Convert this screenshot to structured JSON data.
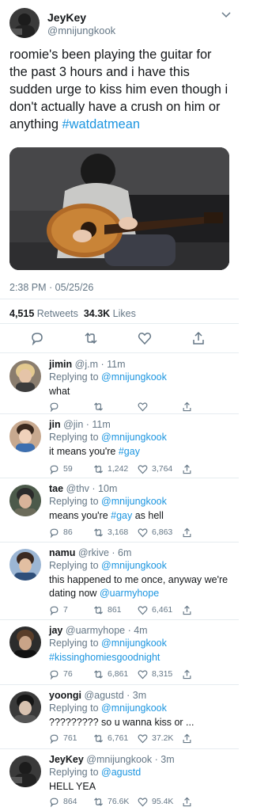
{
  "main_tweet": {
    "display_name": "JeyKey",
    "handle": "@mnijungkook",
    "text_parts": [
      "roomie's been playing the guitar for the past 3 hours and i have this sudden urge to kiss him even though i don't actually have a crush on him or anything ",
      "#watdatmean"
    ],
    "timestamp": "2:38 PM · 05/25/26",
    "retweets_count": "4,515",
    "retweets_label": "Retweets",
    "likes_count": "34.3K",
    "likes_label": "Likes",
    "icons": [
      "reply-icon",
      "retweet-icon",
      "like-icon",
      "share-icon"
    ]
  },
  "replies": [
    {
      "display_name": "jimin",
      "handle": "@j.m",
      "time": "11m",
      "replying_prefix": "Replying to ",
      "replying_to": "@mnijungkook",
      "text": [
        "what"
      ],
      "reply_count": "",
      "retweet_count": "",
      "like_count": ""
    },
    {
      "display_name": "jin",
      "handle": "@jin",
      "time": "11m",
      "replying_prefix": "Replying to ",
      "replying_to": "@mnijungkook",
      "text": [
        "it means you're ",
        "#gay"
      ],
      "reply_count": "59",
      "retweet_count": "1,242",
      "like_count": "3,764"
    },
    {
      "display_name": "tae",
      "handle": "@thv",
      "time": "10m",
      "replying_prefix": "Replying to ",
      "replying_to": "@mnijungkook",
      "text": [
        "means you're ",
        "#gay",
        " as hell"
      ],
      "reply_count": "86",
      "retweet_count": "3,168",
      "like_count": "6,863"
    },
    {
      "display_name": "namu",
      "handle": "@rkive",
      "time": "6m",
      "replying_prefix": "Replying to ",
      "replying_to": "@mnijungkook",
      "text": [
        "this happened to me once, anyway we're",
        "dating now ",
        "@uarmyhope"
      ],
      "reply_count": "7",
      "retweet_count": "861",
      "like_count": "6,461"
    },
    {
      "display_name": "jay",
      "handle": "@uarmyhope",
      "time": "4m",
      "replying_prefix": "Replying to ",
      "replying_to": "@mnijungkook",
      "text": [
        "#kissinghomiesgoodnight"
      ],
      "reply_count": "76",
      "retweet_count": "6,861",
      "like_count": "8,315"
    },
    {
      "display_name": "yoongi",
      "handle": "@agustd",
      "time": "3m",
      "replying_prefix": "Replying to ",
      "replying_to": "@mnijungkook",
      "text": [
        "????????? so u wanna kiss or ..."
      ],
      "reply_count": "761",
      "retweet_count": "6,761",
      "like_count": "37.2K"
    },
    {
      "display_name": "JeyKey",
      "handle": "@mnijungkook",
      "time": "3m",
      "replying_prefix": "Replying to ",
      "replying_to": "@agustd",
      "text": [
        "HELL YEA"
      ],
      "reply_count": "864",
      "retweet_count": "76.6K",
      "like_count": "95.4K"
    }
  ],
  "colors": {
    "text": "#14171a",
    "secondary": "#657786",
    "link": "#1b95e0",
    "divider": "#e6ecf0"
  }
}
